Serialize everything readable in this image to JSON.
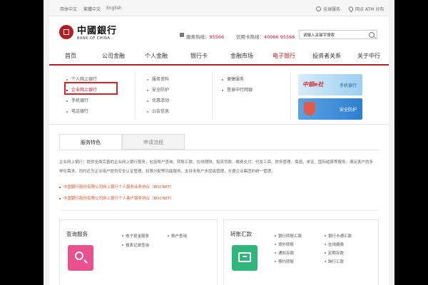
{
  "topbar": {
    "lang_left": "简体中文",
    "lang_mid": "繁體中文",
    "lang_en": "English",
    "sitemap": "全球服务",
    "location": "网点 ATM 分布"
  },
  "logo": {
    "cn": "中國銀行",
    "en": "BANK OF CHINA"
  },
  "hotline": {
    "service_label": "服务热线：",
    "service_num": "95566",
    "card_label": "信用卡热线：",
    "card_num": "40066 95566"
  },
  "search": {
    "value": "请输入关键字搜索"
  },
  "nav": [
    {
      "label": "首页"
    },
    {
      "label": "公司金融"
    },
    {
      "label": "个人金融"
    },
    {
      "label": "银行卡"
    },
    {
      "label": "金融市场"
    },
    {
      "label": "电子银行"
    },
    {
      "label": "投资者关系"
    },
    {
      "label": "关于中行"
    }
  ],
  "dropdown": {
    "col1": [
      "个人网上银行",
      "企业网上银行",
      "手机银行",
      "电话银行"
    ],
    "col2": [
      "服务资料",
      "安全防护",
      "优惠活动",
      "公告信息"
    ],
    "col3": [
      "便捷服务",
      "登录中行网银"
    ],
    "banner1": {
      "promo": "中银e社",
      "label": "手机银行"
    },
    "banner2": {
      "label": "安全防护"
    }
  },
  "tabs": [
    {
      "label": "服务特色"
    },
    {
      "label": "申请流程"
    }
  ],
  "desc": "企业网上银行：提供全面完善的企业网上银行服务，包括账户查询、转账汇款、在线理财、投资贷款、缴费支付、代发工资、财务管理、保函、单证、国际结算等服务，满足客户的多样化需求。同时还为企业用户提供安全认证管理、权限分配等功能服务，支持多账户多层级管理，方便企业集团的统一管理。",
  "links": [
    "中国银行股份有限公司网上银行个人服务业务协议（BOCNET）",
    "中国银行股份有限公司网上银行个人客户服务协议（BOCNET）"
  ],
  "panel1": {
    "title": "查询服务",
    "items": [
      "电子现金服务",
      "账户查询",
      "报表记录查询"
    ]
  },
  "panel2": {
    "title": "转账汇款",
    "items": [
      "银行转账汇款",
      "银行卡通汇款",
      "境外转账",
      "在线缴费",
      "通知存款",
      "定期存款",
      "预约转账",
      "跨行汇款"
    ]
  },
  "colors": {
    "brand_red": "#b81c22",
    "highlight": "#e02020"
  }
}
